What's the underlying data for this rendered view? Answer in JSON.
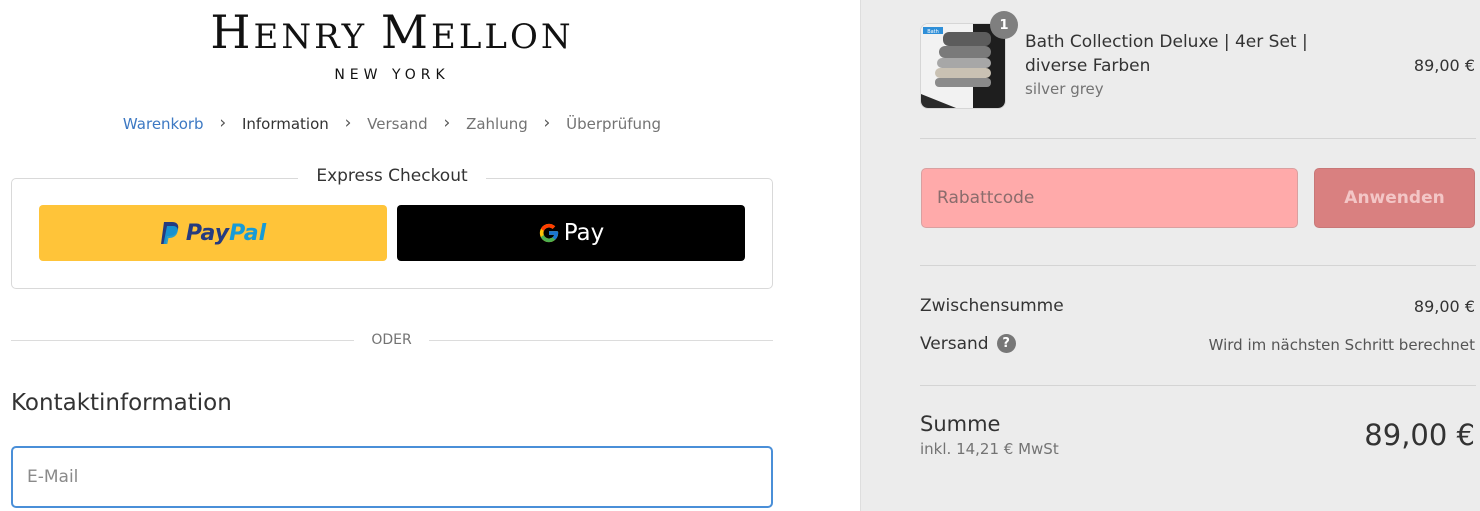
{
  "brand": {
    "name_first_initial": "H",
    "name_first_rest": "ENRY",
    "name_last_initial": "M",
    "name_last_rest": "ELLON",
    "subtitle": "NEW YORK"
  },
  "breadcrumb": {
    "items": [
      {
        "label": "Warenkorb",
        "state": "link"
      },
      {
        "label": "Information",
        "state": "current"
      },
      {
        "label": "Versand",
        "state": "upcoming"
      },
      {
        "label": "Zahlung",
        "state": "upcoming"
      },
      {
        "label": "Überprüfung",
        "state": "upcoming"
      }
    ],
    "separator": "›"
  },
  "express_checkout": {
    "title": "Express Checkout",
    "paypal": {
      "label_pay": "Pay",
      "label_pal": "Pal",
      "color": "#ffc439"
    },
    "gpay": {
      "label": "Pay",
      "color": "#000000"
    }
  },
  "divider_text": "ODER",
  "contact": {
    "title": "Kontaktinformation",
    "email_placeholder": "E-Mail",
    "email_value": ""
  },
  "order_summary": {
    "product": {
      "name": "Bath Collection Deluxe | 4er Set | diverse Farben",
      "variant": "silver grey",
      "price": "89,00 €",
      "quantity": "1",
      "thumb_label": "Bath"
    },
    "discount": {
      "placeholder": "Rabattcode",
      "apply_label": "Anwenden"
    },
    "subtotal_label": "Zwischensumme",
    "subtotal_value": "89,00 €",
    "shipping_label": "Versand",
    "shipping_value": "Wird im nächsten Schritt berechnet",
    "total_label": "Summe",
    "tax_note": "inkl. 14,21 € MwSt",
    "total_value": "89,00 €"
  },
  "colors": {
    "link_blue": "#3d79c3",
    "summary_bg": "#ececec",
    "discount_field_bg": "#ffaaaa",
    "apply_button_bg": "#d98080"
  }
}
